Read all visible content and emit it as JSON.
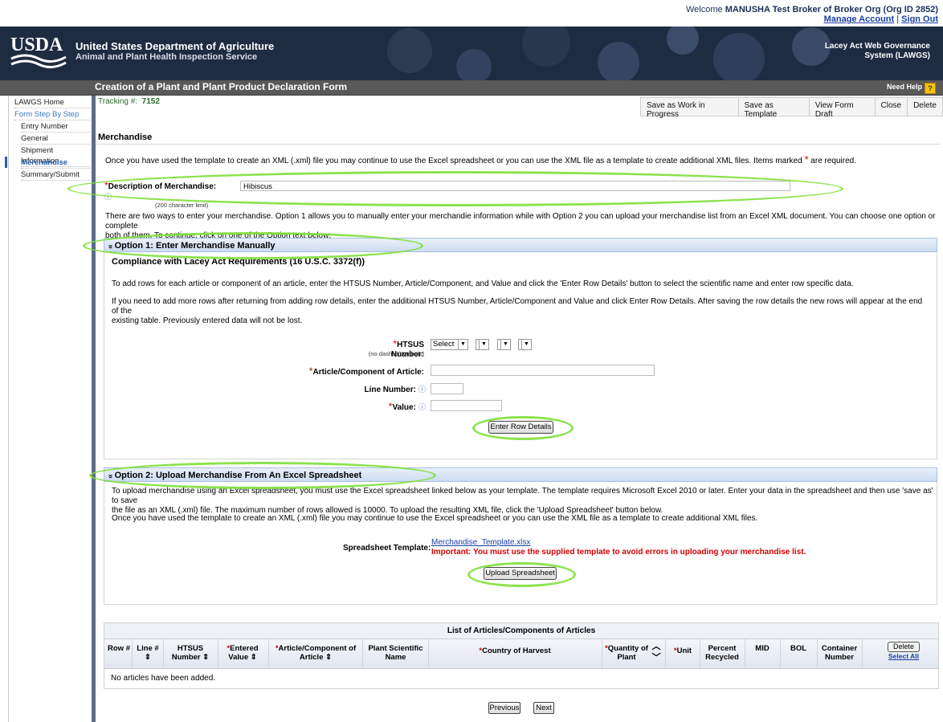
{
  "header": {
    "welcome_prefix": "Welcome",
    "welcome_user": "MANUSHA Test Broker of Broker Org (Org ID 2852)",
    "manage_account": "Manage Account",
    "sign_out": "Sign Out",
    "separator": "|"
  },
  "banner": {
    "logo_text": "USDA",
    "agency_title": "United States Department of Agriculture",
    "agency_subtitle": "Animal and Plant Health Inspection Service",
    "system_name_line1": "Lacey Act Web Governance",
    "system_name_line2": "System (LAWGS)"
  },
  "titlebar": {
    "title": "Creation of a Plant and Plant Product Declaration Form",
    "need_help": "Need Help",
    "help_icon_glyph": "?"
  },
  "sidebar": {
    "items": [
      {
        "label": "LAWGS Home"
      },
      {
        "label": "Form Step By Step"
      },
      {
        "label": "Entry Number"
      },
      {
        "label": "General"
      },
      {
        "label": "Shipment Information"
      },
      {
        "label": "Merchandise"
      },
      {
        "label": "Summary/Submit"
      }
    ]
  },
  "tracking": {
    "label": "Tracking #:",
    "value": "7152"
  },
  "actions": {
    "save_wip": "Save as Work in Progress",
    "save_template": "Save as Template",
    "view_draft": "View Form Draft",
    "close": "Close",
    "delete": "Delete"
  },
  "merchandise": {
    "heading": "Merchandise",
    "intro": "Once you have used the template to create an XML (.xml) file you may continue to use the Excel spreadsheet or you can use the XML file as a template to create additional XML files. Items marked",
    "intro_suffix": "are required.",
    "required_star": "*",
    "description_label": "Description of Merchandise:",
    "description_limit": "(200 character limit)",
    "description_value": "Hibiscus",
    "ways_text_1": "There are two ways to enter your merchandise. Option 1 allows you to manually enter your merchandie information while with Option 2 you can upload your merchandise list from an Excel XML document. You can choose one option or complete",
    "ways_text_2": "both of them. To continue, click on one of the Option text below:"
  },
  "option1": {
    "title": "Option 1: Enter Merchandise Manually",
    "collapse_glyph": "»",
    "compliance": "Compliance with Lacey Act Requirements (16 U.S.C. 3372(f))",
    "p1": "To add rows for each article or component of an article, enter the HTSUS Number, Article/Component, and Value and click the 'Enter Row Details' button to select the scientific name and enter row specific data.",
    "p2": "If you need to add more rows after returning from adding row details, enter the additional HTSUS Number, Article/Component and Value and click Enter Row Details. After saving the row details the new rows will appear at the end of the",
    "p3": "existing table. Previously entered data will not be lost.",
    "htsus_label": "HTSUS Number:",
    "htsus_note": "(no dashes/symbols)",
    "htsus_select": "Select",
    "article_label": "Article/Component of Article:",
    "line_label": "Line Number:",
    "value_label": "Value:",
    "enter_row_btn": "Enter Row Details"
  },
  "option2": {
    "title": "Option 2: Upload Merchandise From An Excel Spreadsheet",
    "collapse_glyph": "»",
    "p1": "To upload merchandise using an Excel spreadsheet, you must use the Excel spreadsheet linked below as your template. The template requires Microsoft Excel 2010 or later. Enter your data in the spreadsheet and then use 'save as' to save",
    "p2": "the file as an XML (.xml) file. The maximum number of rows allowed is 10000. To upload the resulting XML file, click the 'Upload Spreadsheet' button below.",
    "p3": "Once you have used the template to create an XML (.xml) file you may continue to use the Excel spreadsheet or you can use the XML file as a template to create additional XML files.",
    "template_label": "Spreadsheet Template:",
    "template_link": "Merchandise_Template.xlsx",
    "important": "Important: You must use the supplied template to avoid errors in uploading your merchandise list.",
    "upload_btn": "Upload Spreadsheet"
  },
  "articles_table": {
    "caption": "List of Articles/Components of Articles",
    "columns": {
      "row": "Row #",
      "line": "Line #",
      "htsus": "HTSUS Number",
      "entered_value": "Entered Value",
      "article": "Article/Component of Article",
      "scientific": "Plant Scientific Name",
      "country": "Country of Harvest",
      "quantity": "Quantity of Plant",
      "unit": "Unit",
      "percent": "Percent Recycled",
      "mid": "MID",
      "bol": "BOL",
      "container": "Container Number",
      "delete": "Delete",
      "select_all": "Select All"
    },
    "empty_message": "No articles have been added."
  },
  "pager": {
    "previous": "Previous",
    "next": "Next"
  },
  "colors": {
    "banner": "#1e2c42",
    "titlebar": "#595959",
    "highlight": "#7ee03a",
    "required": "#d40000",
    "rail": "#5b6d88"
  }
}
